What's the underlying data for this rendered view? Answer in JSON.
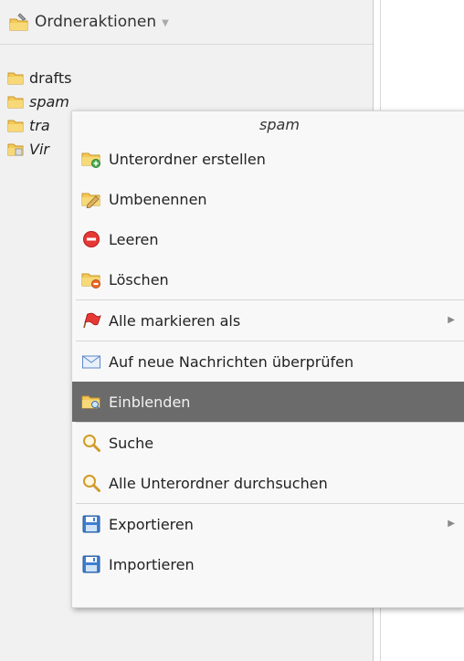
{
  "header": {
    "title": "Ordneraktionen"
  },
  "folders": [
    {
      "label": "drafts",
      "style": "normal"
    },
    {
      "label": "spam",
      "style": "italic"
    },
    {
      "label": "tra",
      "style": "italic"
    },
    {
      "label": "Vir",
      "style": "italic"
    }
  ],
  "context_menu": {
    "title": "spam",
    "items": [
      {
        "label": "Unterordner erstellen",
        "icon": "folder-add-icon"
      },
      {
        "label": "Umbenennen",
        "icon": "folder-rename-icon"
      },
      {
        "label": "Leeren",
        "icon": "empty-icon"
      },
      {
        "label": "Löschen",
        "icon": "folder-delete-icon"
      },
      {
        "label": "Alle markieren als",
        "icon": "flag-icon",
        "submenu": true
      },
      {
        "label": "Auf neue Nachrichten überprüfen",
        "icon": "envelope-icon"
      },
      {
        "label": "Einblenden",
        "icon": "folder-view-icon",
        "active": true
      },
      {
        "label": "Suche",
        "icon": "search-icon"
      },
      {
        "label": "Alle Unterordner durchsuchen",
        "icon": "search-subfolders-icon"
      },
      {
        "label": "Exportieren",
        "icon": "save-icon",
        "submenu": true
      },
      {
        "label": "Importieren",
        "icon": "save-icon"
      }
    ]
  },
  "colors": {
    "active_bg": "#6b6b6b",
    "folder": "#f3c957",
    "pane_bg": "#f1f1f1"
  }
}
